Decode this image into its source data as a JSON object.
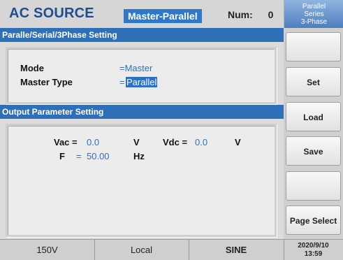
{
  "header": {
    "title": "AC SOURCE",
    "mode_badge": "Master-Parallel",
    "num_label": "Num:",
    "num_value": "0"
  },
  "side_menu": {
    "top_lines": [
      "Parallel",
      "Series",
      "3-Phase"
    ],
    "keys": [
      "",
      "Set",
      "Load",
      "Save",
      "",
      "Page Select"
    ]
  },
  "sections": {
    "setting_title": "Paralle/Serial/3Phase  Setting",
    "output_title": "Output Parameter  Setting"
  },
  "setting": {
    "mode_label": "Mode",
    "mode_value": "=Master",
    "master_type_label": "Master  Type",
    "master_type_eq": "=",
    "master_type_value": "Parallel"
  },
  "output": {
    "vac_label": "Vac =",
    "vac_value": "0.0",
    "vac_unit": "V",
    "vdc_label": "Vdc =",
    "vdc_value": "0.0",
    "vdc_unit": "V",
    "f_label": "F",
    "f_eq": "=",
    "f_value": "50.00",
    "f_unit": "Hz"
  },
  "status": {
    "range": "150V",
    "remote": "Local",
    "waveform": "SINE",
    "date": "2020/9/10",
    "time": "13:59"
  },
  "colors": {
    "accent": "#2f6fb8",
    "value_blue": "#2b72c6",
    "title_blue": "#1f4e8f"
  }
}
